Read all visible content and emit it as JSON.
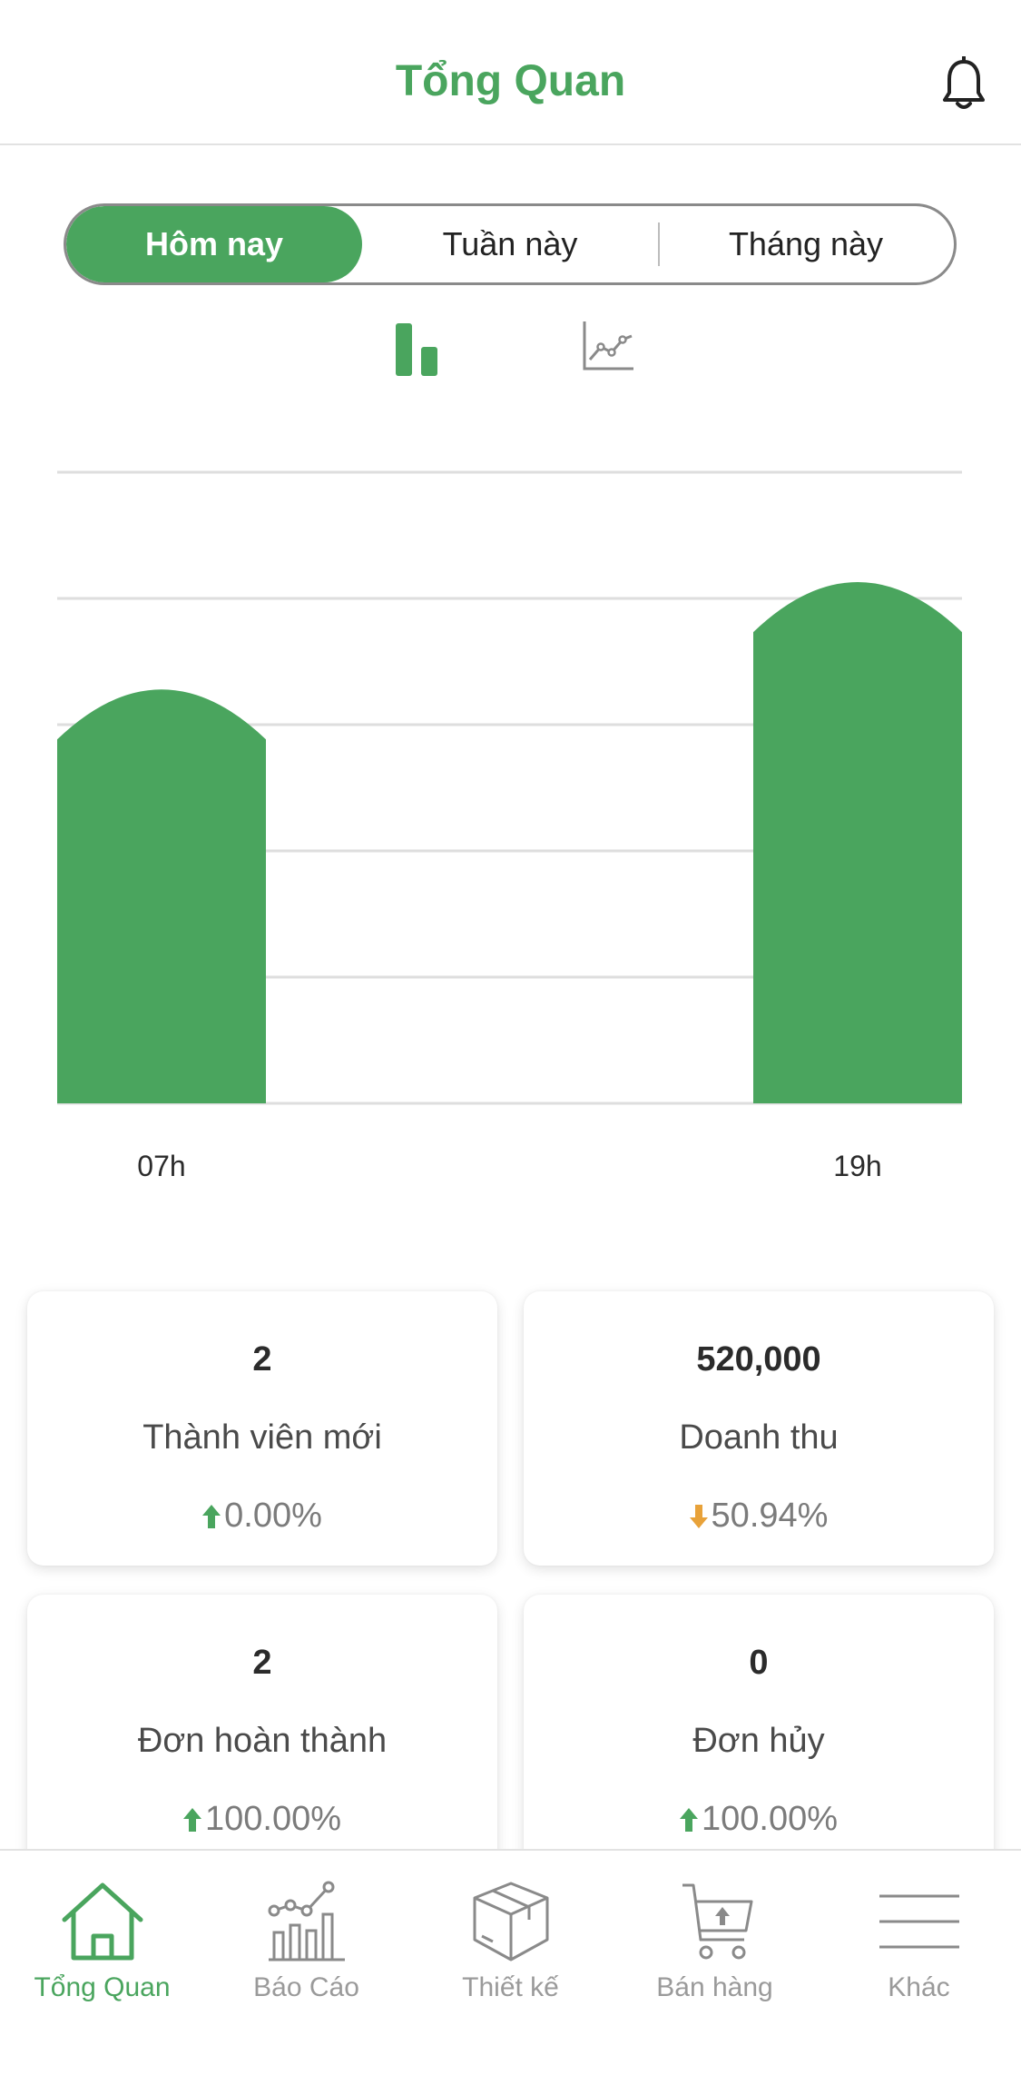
{
  "header": {
    "title": "Tổng Quan"
  },
  "period_tabs": [
    {
      "label": "Hôm nay",
      "active": true
    },
    {
      "label": "Tuần này",
      "active": false
    },
    {
      "label": "Tháng này",
      "active": false
    }
  ],
  "chart_toggle": {
    "selected": "bar",
    "options": [
      "bar-chart-icon",
      "line-chart-icon"
    ]
  },
  "colors": {
    "accent": "#4aa55e",
    "up": "#4aa55e",
    "down": "#e8a23a",
    "muted": "#9a9a9a"
  },
  "chart_data": {
    "type": "bar",
    "categories": [
      "07h",
      "19h"
    ],
    "values": [
      3.3,
      4.15
    ],
    "ylim": [
      0,
      5
    ],
    "grid": true,
    "gridlines": 5
  },
  "stats": [
    {
      "value": "2",
      "label": "Thành viên mới",
      "change": "0.00%",
      "direction": "up"
    },
    {
      "value": "520,000",
      "label": "Doanh thu",
      "change": "50.94%",
      "direction": "down"
    },
    {
      "value": "2",
      "label": "Đơn hoàn thành",
      "change": "100.00%",
      "direction": "up"
    },
    {
      "value": "0",
      "label": "Đơn hủy",
      "change": "100.00%",
      "direction": "up"
    }
  ],
  "tabbar": [
    {
      "label": "Tổng Quan",
      "icon": "home-icon",
      "active": true
    },
    {
      "label": "Báo Cáo",
      "icon": "report-chart-icon",
      "active": false
    },
    {
      "label": "Thiết kế",
      "icon": "box-icon",
      "active": false
    },
    {
      "label": "Bán hàng",
      "icon": "cart-icon",
      "active": false
    },
    {
      "label": "Khác",
      "icon": "menu-icon",
      "active": false
    }
  ]
}
